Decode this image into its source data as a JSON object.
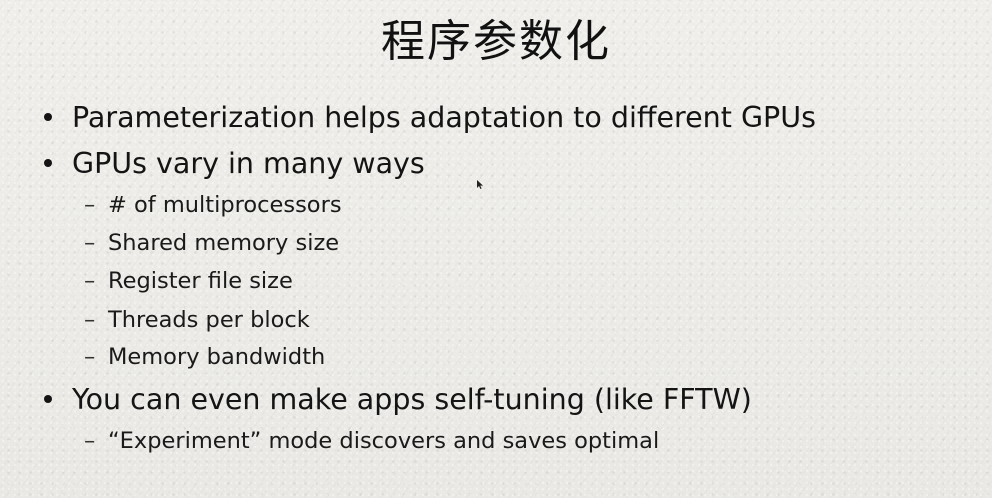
{
  "title": "程序参数化",
  "bullets": [
    {
      "text": "Parameterization helps adaptation to  different GPUs",
      "subs": []
    },
    {
      "text": "GPUs vary in many ways",
      "subs": [
        "# of multiprocessors",
        "Shared memory size",
        "Register file size",
        "Threads per block",
        "Memory bandwidth"
      ]
    },
    {
      "text": "You can even make apps self-tuning (like  FFTW)",
      "subs": [
        "“Experiment” mode discovers and saves optimal"
      ]
    }
  ],
  "sub_marker": "–"
}
